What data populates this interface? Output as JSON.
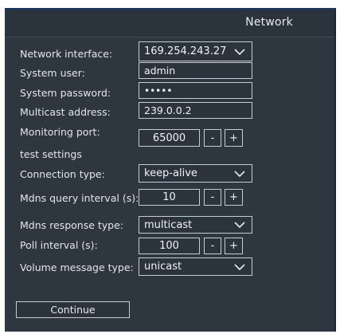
{
  "window": {
    "title": "Network"
  },
  "form": {
    "network_interface": {
      "label": "Network interface:",
      "value": "169.254.243.27"
    },
    "system_user": {
      "label": "System user:",
      "value": "admin"
    },
    "system_password": {
      "label": "System password:",
      "value": "•••••"
    },
    "multicast_address": {
      "label": "Multicast address:",
      "value": "239.0.0.2"
    },
    "monitoring_port": {
      "label": "Monitoring port:",
      "value": "65000",
      "dec": "-",
      "inc": "+"
    },
    "test_settings": {
      "label": "test settings"
    },
    "connection_type": {
      "label": "Connection type:",
      "value": "keep-alive"
    },
    "mdns_query_interval": {
      "label": "Mdns query interval (s):",
      "value": "10",
      "dec": "-",
      "inc": "+"
    },
    "mdns_response_type": {
      "label": "Mdns response type:",
      "value": "multicast"
    },
    "poll_interval": {
      "label": "Poll interval (s):",
      "value": "100",
      "dec": "-",
      "inc": "+"
    },
    "volume_message_type": {
      "label": "Volume message type:",
      "value": "unicast"
    }
  },
  "actions": {
    "continue_label": "Continue"
  },
  "icons": {
    "dropdown": "chevron-down-icon"
  }
}
